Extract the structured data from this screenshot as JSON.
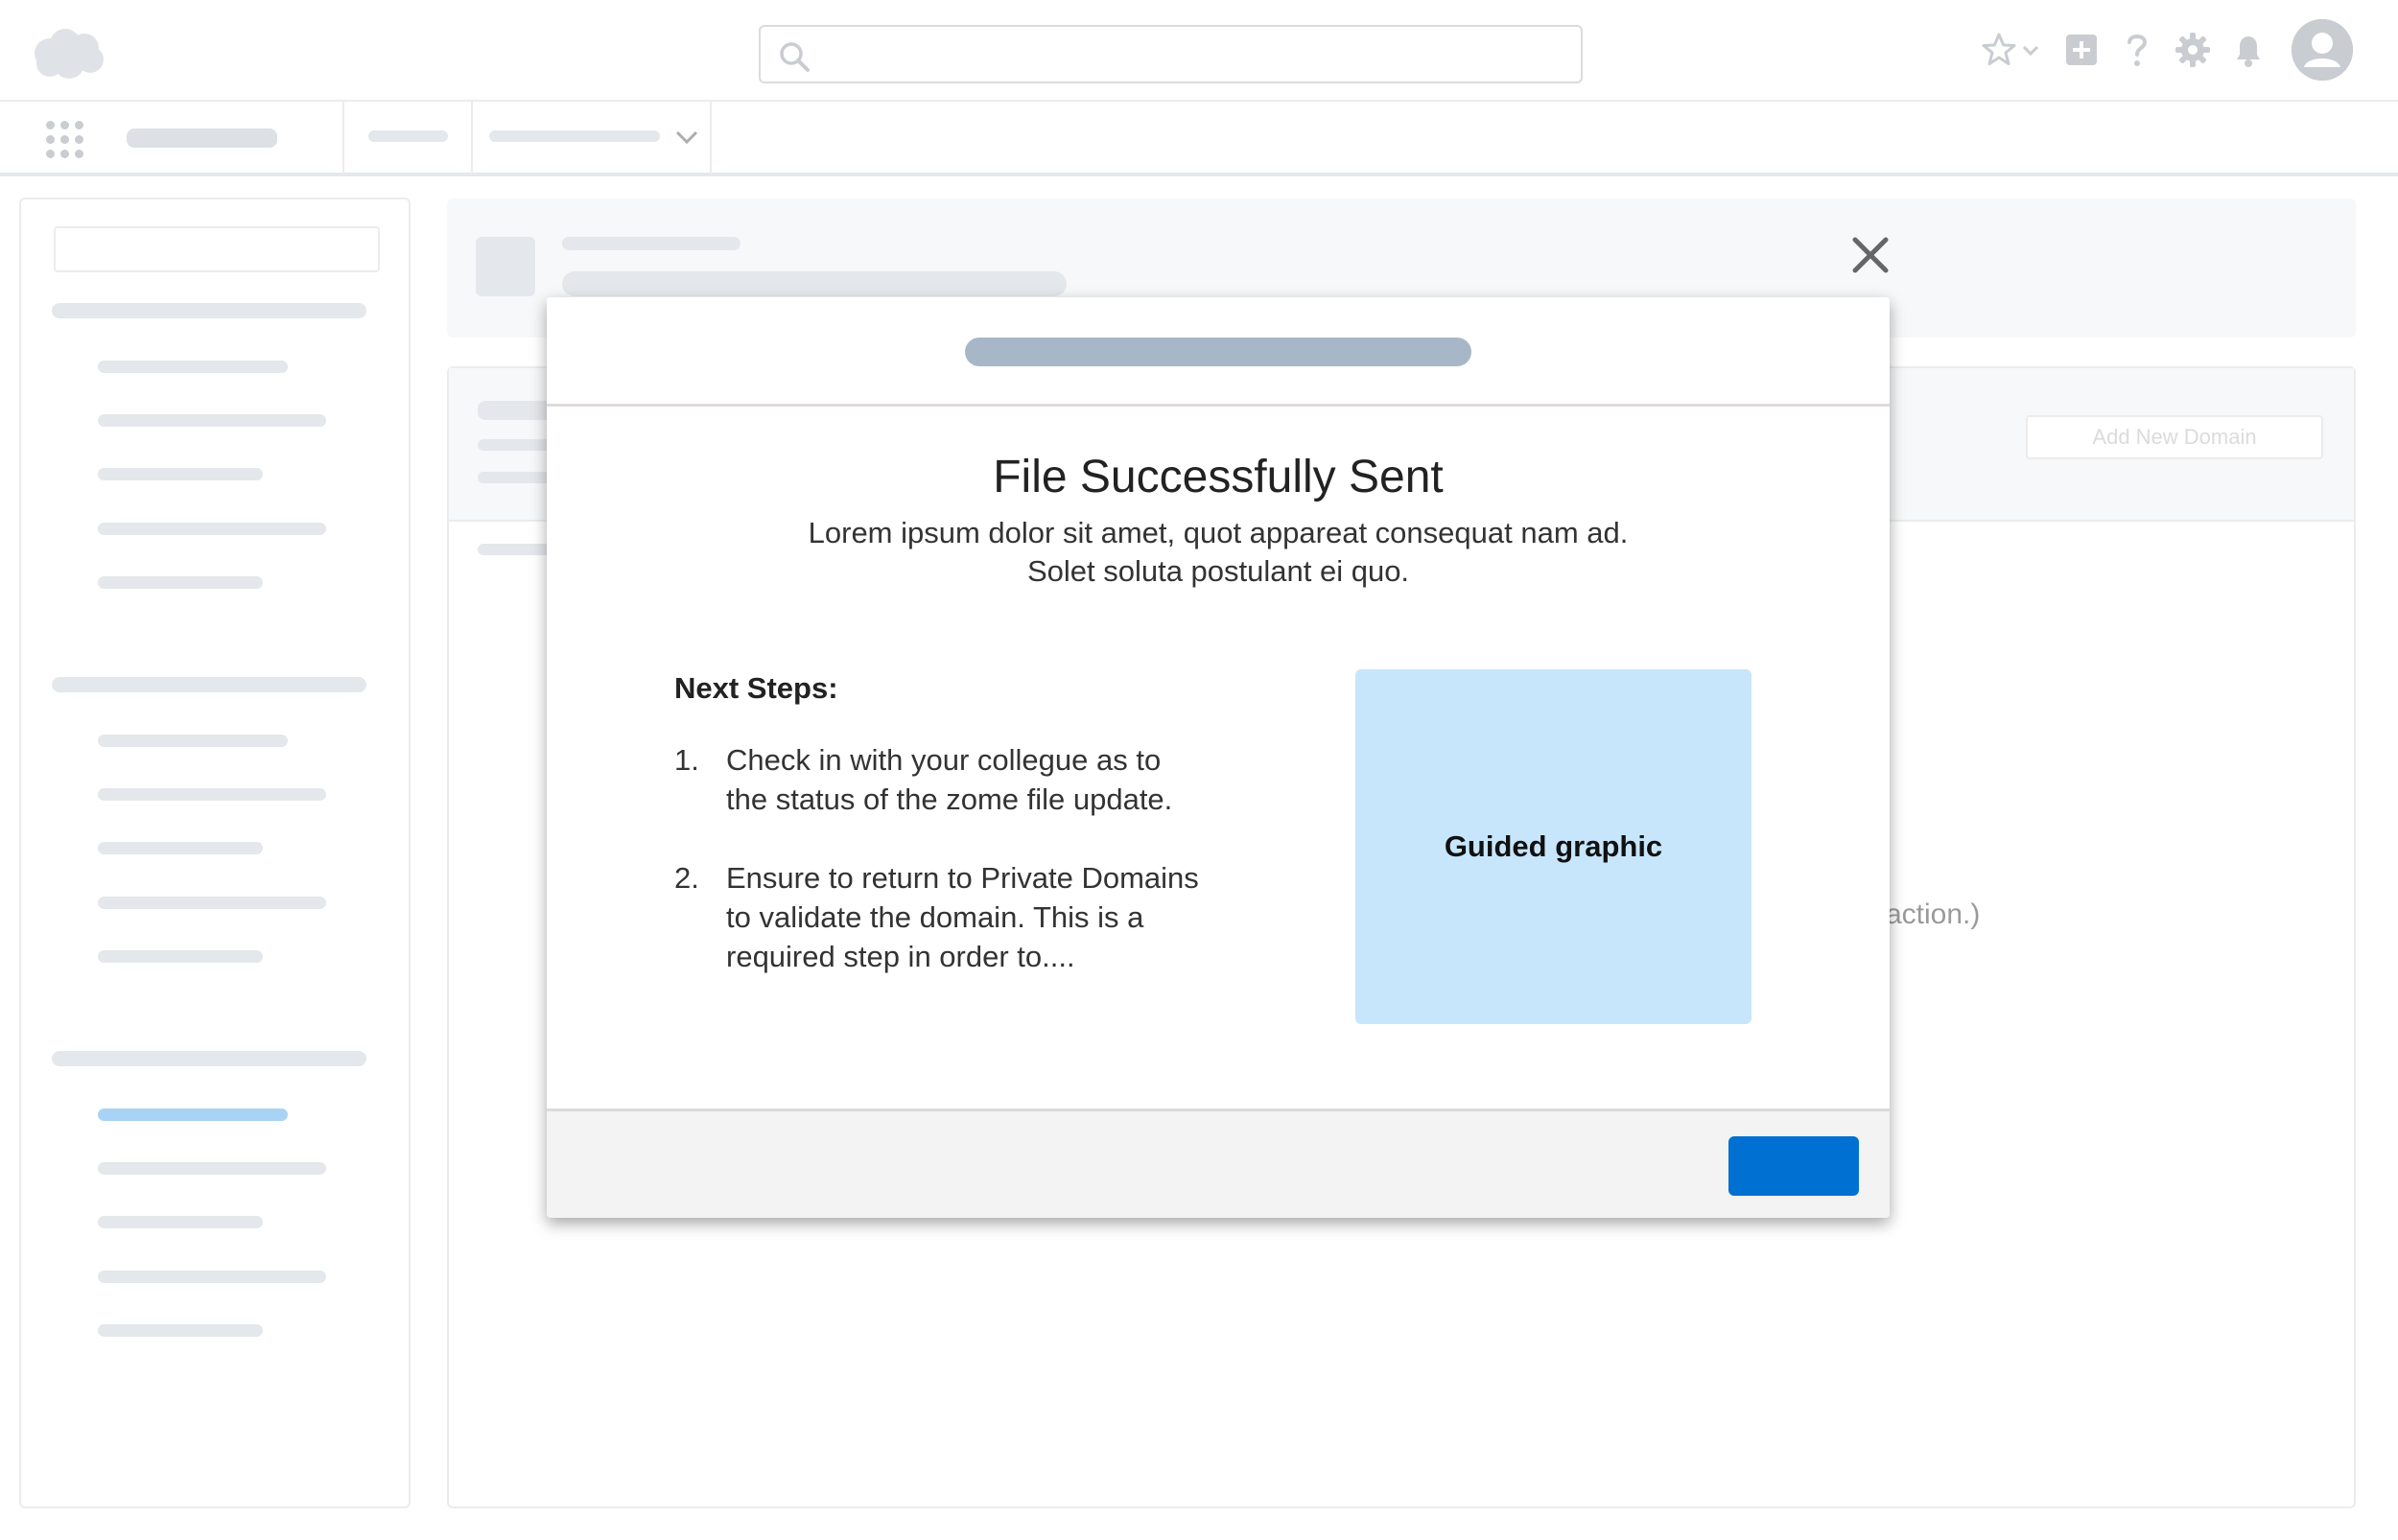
{
  "header": {
    "search": {
      "value": "",
      "placeholder": ""
    },
    "icons": [
      "cloud-logo-icon",
      "search-icon",
      "star-icon",
      "chevron-down-icon",
      "add-icon",
      "help-icon",
      "gear-icon",
      "bell-icon",
      "user-avatar-icon"
    ]
  },
  "background": {
    "add_domain_label": "Add New Domain",
    "partial_text": "action.)"
  },
  "modal": {
    "title": "File Successfully Sent",
    "description_line1": "Lorem ipsum dolor sit amet, quot appareat consequat nam ad.",
    "description_line2": "Solet soluta postulant ei quo.",
    "next_steps_title": "Next Steps:",
    "steps": [
      {
        "num": "1.",
        "line1": "Check in with your collegue as to",
        "line2": "the status of the zome file update.",
        "line3": ""
      },
      {
        "num": "2.",
        "line1": "Ensure to return to Private Domains",
        "line2": "to validate the domain. This is a",
        "line3": "required step in order to...."
      }
    ],
    "graphic_label": "Guided graphic",
    "primary_button_label": ""
  },
  "colors": {
    "brand_blue": "#0070d2",
    "graphic_bg": "#c7e6fc",
    "skeleton": "#e4e7eb",
    "active_nav": "#a9d3f5"
  }
}
